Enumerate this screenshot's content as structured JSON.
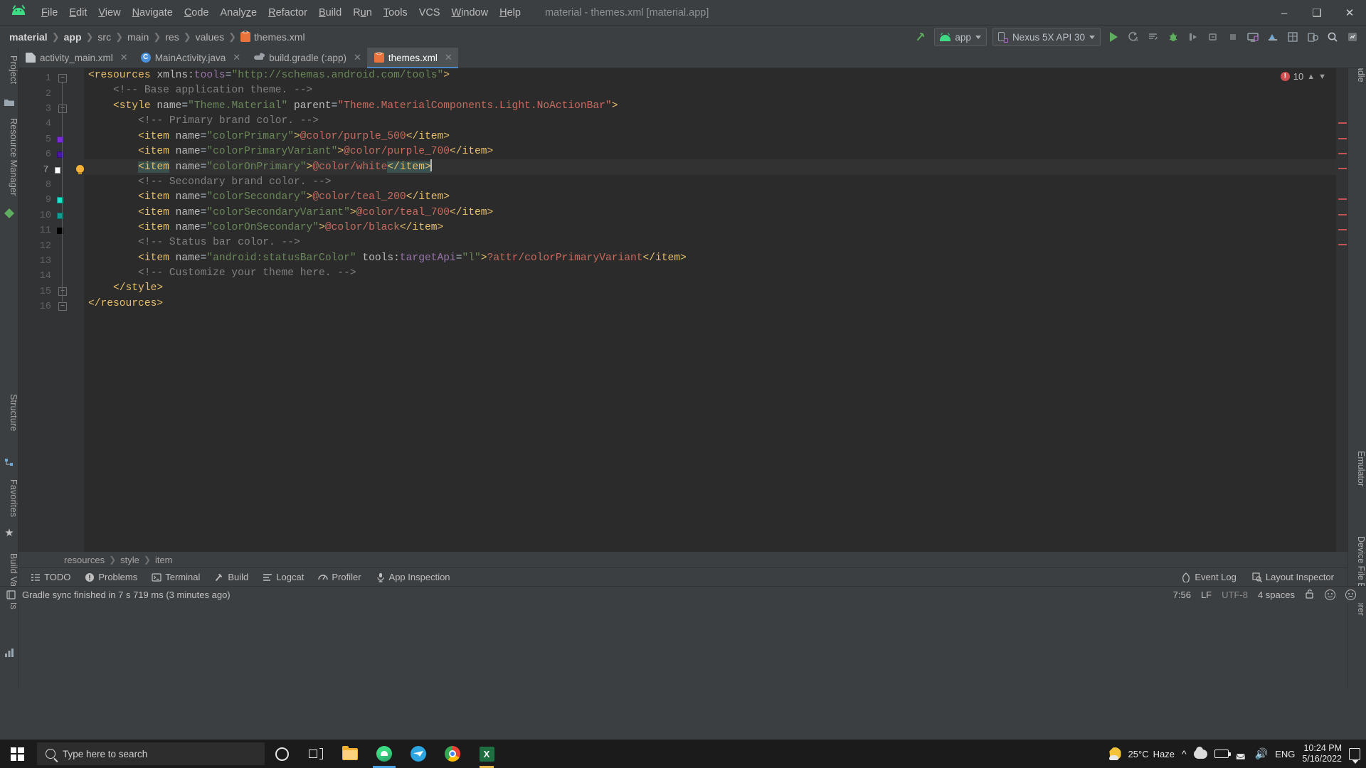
{
  "window": {
    "title": "material - themes.xml [material.app]",
    "app_icon": "android-logo-icon",
    "controls": {
      "minimize": "—",
      "maximize": "❐",
      "close": "✕"
    }
  },
  "menu": [
    {
      "label": "File",
      "mnemonic": "F"
    },
    {
      "label": "Edit",
      "mnemonic": "E"
    },
    {
      "label": "View",
      "mnemonic": "V"
    },
    {
      "label": "Navigate",
      "mnemonic": "N"
    },
    {
      "label": "Code",
      "mnemonic": "C"
    },
    {
      "label": "Analyze",
      "mnemonic": "z"
    },
    {
      "label": "Refactor",
      "mnemonic": "R"
    },
    {
      "label": "Build",
      "mnemonic": "B"
    },
    {
      "label": "Run",
      "mnemonic": "u"
    },
    {
      "label": "Tools",
      "mnemonic": "T"
    },
    {
      "label": "VCS",
      "mnemonic": ""
    },
    {
      "label": "Window",
      "mnemonic": "W"
    },
    {
      "label": "Help",
      "mnemonic": "H"
    }
  ],
  "breadcrumbs": [
    {
      "label": "material",
      "bold": true
    },
    {
      "label": "app",
      "bold": true
    },
    {
      "label": "src",
      "bold": false
    },
    {
      "label": "main",
      "bold": false
    },
    {
      "label": "res",
      "bold": false
    },
    {
      "label": "values",
      "bold": false
    },
    {
      "label": "themes.xml",
      "bold": false,
      "icon": "xml-file-icon"
    }
  ],
  "toolbar": {
    "build_hammer": "build-icon",
    "module_selector": "app",
    "device_selector": "Nexus 5X API 30",
    "run_button": "run-icon",
    "apply_changes": "apply-changes-icon",
    "apply_code_changes": "apply-code-changes-icon",
    "debug_button": "debug-icon",
    "profile_button": "profile-icon",
    "attach_debugger": "attach-debugger-icon",
    "stop_button": "stop-icon",
    "avd_manager": "avd-manager-icon",
    "sdk_manager": "sdk-manager-icon",
    "layout_inspector": "layout-inspector-icon",
    "device_file_explorer": "device-file-explorer-icon",
    "search_everywhere": "search-icon",
    "profiler": "profiler-icon"
  },
  "tabs": [
    {
      "label": "activity_main.xml",
      "icon": "xml-layout-icon",
      "active": false
    },
    {
      "label": "MainActivity.java",
      "icon": "java-class-icon",
      "active": false
    },
    {
      "label": "build.gradle (:app)",
      "icon": "gradle-icon",
      "active": false
    },
    {
      "label": "themes.xml",
      "icon": "xml-values-icon",
      "active": true
    }
  ],
  "left_tool_window_bars": [
    {
      "label": "Project",
      "icon": "project-icon"
    },
    {
      "label": "Resource Manager",
      "icon": "resource-manager-icon"
    },
    {
      "label": "Structure",
      "icon": "structure-icon"
    },
    {
      "label": "Favorites",
      "icon": "favorites-star-icon"
    },
    {
      "label": "Build Variants",
      "icon": "build-variants-icon"
    }
  ],
  "right_tool_window_bars": [
    {
      "label": "Gradle",
      "icon": "gradle-icon"
    },
    {
      "label": "Emulator",
      "icon": "emulator-icon"
    },
    {
      "label": "Device File Explorer",
      "icon": "device-file-explorer-icon"
    }
  ],
  "editor": {
    "file": "themes.xml",
    "error_count": "10",
    "gutter_swatches": {
      "5": "#7f2bdc",
      "6": "#4a16a8",
      "7": "#ffffff",
      "9": "#17e5cb",
      "10": "#0e9d92",
      "11": "#000000"
    },
    "intention_bulb_line": 7,
    "caret_position": "7:56",
    "lines": [
      {
        "n": 1,
        "fold": "minus",
        "tokens": [
          {
            "t": "<",
            "c": "t-tag"
          },
          {
            "t": "resources",
            "c": "t-tag"
          },
          {
            "t": " ",
            "c": "t-text"
          },
          {
            "t": "xmlns:",
            "c": "t-attr"
          },
          {
            "t": "tools",
            "c": "t-ns"
          },
          {
            "t": "=",
            "c": "t-text"
          },
          {
            "t": "\"http://schemas.android.com/tools\"",
            "c": "t-val"
          },
          {
            "t": ">",
            "c": "t-tag"
          }
        ]
      },
      {
        "n": 2,
        "tokens": [
          {
            "t": "    <!-- Base application theme. -->",
            "c": "t-com"
          }
        ]
      },
      {
        "n": 3,
        "fold": "minus",
        "tokens": [
          {
            "t": "    <",
            "c": "t-tag"
          },
          {
            "t": "style ",
            "c": "t-tag"
          },
          {
            "t": "name",
            "c": "t-attr"
          },
          {
            "t": "=",
            "c": "t-text"
          },
          {
            "t": "\"Theme.Material\"",
            "c": "t-val"
          },
          {
            "t": " ",
            "c": "t-text"
          },
          {
            "t": "parent",
            "c": "t-attr"
          },
          {
            "t": "=",
            "c": "t-text"
          },
          {
            "t": "\"Theme.MaterialComponents.Light.NoActionBar\"",
            "c": "t-redstr"
          },
          {
            "t": ">",
            "c": "t-tag"
          }
        ]
      },
      {
        "n": 4,
        "tokens": [
          {
            "t": "        <!-- Primary brand color. -->",
            "c": "t-com"
          }
        ]
      },
      {
        "n": 5,
        "tokens": [
          {
            "t": "        <",
            "c": "t-tag"
          },
          {
            "t": "item ",
            "c": "t-tag"
          },
          {
            "t": "name",
            "c": "t-attr"
          },
          {
            "t": "=",
            "c": "t-text"
          },
          {
            "t": "\"colorPrimary\"",
            "c": "t-val"
          },
          {
            "t": ">",
            "c": "t-tag"
          },
          {
            "t": "@color/purple_500",
            "c": "t-redstr"
          },
          {
            "t": "</item>",
            "c": "t-tag"
          }
        ]
      },
      {
        "n": 6,
        "tokens": [
          {
            "t": "        <",
            "c": "t-tag"
          },
          {
            "t": "item ",
            "c": "t-tag"
          },
          {
            "t": "name",
            "c": "t-attr"
          },
          {
            "t": "=",
            "c": "t-text"
          },
          {
            "t": "\"colorPrimaryVariant\"",
            "c": "t-val"
          },
          {
            "t": ">",
            "c": "t-tag"
          },
          {
            "t": "@color/purple_700",
            "c": "t-redstr"
          },
          {
            "t": "</item>",
            "c": "t-tag"
          }
        ]
      },
      {
        "n": 7,
        "current": true,
        "tokens": [
          {
            "t": "        ",
            "c": "t-text"
          },
          {
            "t": "<item",
            "c": "t-tag hl-ident"
          },
          {
            "t": " ",
            "c": "t-text"
          },
          {
            "t": "name",
            "c": "t-attr"
          },
          {
            "t": "=",
            "c": "t-text"
          },
          {
            "t": "\"colorOnPrimary\"",
            "c": "t-val"
          },
          {
            "t": ">",
            "c": "t-tag"
          },
          {
            "t": "@color/white",
            "c": "t-redstr"
          },
          {
            "t": "</item>",
            "c": "t-tag hl-ident"
          }
        ]
      },
      {
        "n": 8,
        "tokens": [
          {
            "t": "        <!-- Secondary brand color. -->",
            "c": "t-com"
          }
        ]
      },
      {
        "n": 9,
        "tokens": [
          {
            "t": "        <",
            "c": "t-tag"
          },
          {
            "t": "item ",
            "c": "t-tag"
          },
          {
            "t": "name",
            "c": "t-attr"
          },
          {
            "t": "=",
            "c": "t-text"
          },
          {
            "t": "\"colorSecondary\"",
            "c": "t-val"
          },
          {
            "t": ">",
            "c": "t-tag"
          },
          {
            "t": "@color/teal_200",
            "c": "t-redstr"
          },
          {
            "t": "</item>",
            "c": "t-tag"
          }
        ]
      },
      {
        "n": 10,
        "tokens": [
          {
            "t": "        <",
            "c": "t-tag"
          },
          {
            "t": "item ",
            "c": "t-tag"
          },
          {
            "t": "name",
            "c": "t-attr"
          },
          {
            "t": "=",
            "c": "t-text"
          },
          {
            "t": "\"colorSecondaryVariant\"",
            "c": "t-val"
          },
          {
            "t": ">",
            "c": "t-tag"
          },
          {
            "t": "@color/teal_700",
            "c": "t-redstr"
          },
          {
            "t": "</item>",
            "c": "t-tag"
          }
        ]
      },
      {
        "n": 11,
        "tokens": [
          {
            "t": "        <",
            "c": "t-tag"
          },
          {
            "t": "item ",
            "c": "t-tag"
          },
          {
            "t": "name",
            "c": "t-attr"
          },
          {
            "t": "=",
            "c": "t-text"
          },
          {
            "t": "\"colorOnSecondary\"",
            "c": "t-val"
          },
          {
            "t": ">",
            "c": "t-tag"
          },
          {
            "t": "@color/black",
            "c": "t-redstr"
          },
          {
            "t": "</item>",
            "c": "t-tag"
          }
        ]
      },
      {
        "n": 12,
        "tokens": [
          {
            "t": "        <!-- Status bar color. -->",
            "c": "t-com"
          }
        ]
      },
      {
        "n": 13,
        "tokens": [
          {
            "t": "        <",
            "c": "t-tag"
          },
          {
            "t": "item ",
            "c": "t-tag"
          },
          {
            "t": "name",
            "c": "t-attr"
          },
          {
            "t": "=",
            "c": "t-text"
          },
          {
            "t": "\"android:statusBarColor\"",
            "c": "t-val"
          },
          {
            "t": " ",
            "c": "t-text"
          },
          {
            "t": "tools:",
            "c": "t-attr"
          },
          {
            "t": "targetApi",
            "c": "t-ns"
          },
          {
            "t": "=",
            "c": "t-text"
          },
          {
            "t": "\"l\"",
            "c": "t-val"
          },
          {
            "t": ">",
            "c": "t-tag"
          },
          {
            "t": "?attr/colorPrimaryVariant",
            "c": "t-redstr"
          },
          {
            "t": "</item>",
            "c": "t-tag"
          }
        ]
      },
      {
        "n": 14,
        "tokens": [
          {
            "t": "        <!-- Customize your theme here. -->",
            "c": "t-com"
          }
        ]
      },
      {
        "n": 15,
        "fold": "minus",
        "tokens": [
          {
            "t": "    </style>",
            "c": "t-tag"
          }
        ]
      },
      {
        "n": 16,
        "fold": "minus",
        "tokens": [
          {
            "t": "</resources>",
            "c": "t-tag"
          }
        ]
      }
    ],
    "breadcrumb_footer": [
      "resources",
      "style",
      "item"
    ]
  },
  "tool_windows": [
    {
      "label": "TODO",
      "icon": "todo-icon"
    },
    {
      "label": "Problems",
      "icon": "problems-icon"
    },
    {
      "label": "Terminal",
      "icon": "terminal-icon"
    },
    {
      "label": "Build",
      "icon": "build-hammer-icon"
    },
    {
      "label": "Logcat",
      "icon": "logcat-icon"
    },
    {
      "label": "Profiler",
      "icon": "profiler-icon"
    },
    {
      "label": "App Inspection",
      "icon": "app-inspection-icon"
    }
  ],
  "tool_windows_right": [
    {
      "label": "Event Log",
      "icon": "event-log-icon"
    },
    {
      "label": "Layout Inspector",
      "icon": "layout-inspector-icon"
    }
  ],
  "status_bar": {
    "message": "Gradle sync finished in 7 s 719 ms (3 minutes ago)",
    "caret": "7:56",
    "line_separator": "LF",
    "encoding": "UTF-8",
    "indent": "4 spaces",
    "lock_icon": "unlocked-icon",
    "happy_icon": "happy-face-icon",
    "sad_icon": "sad-face-icon"
  },
  "taskbar": {
    "search_placeholder": "Type here to search",
    "start_icon": "windows-start-icon",
    "items": [
      {
        "icon": "cortana-icon",
        "name": "cortana"
      },
      {
        "icon": "task-view-icon",
        "name": "task-view"
      },
      {
        "icon": "file-explorer-icon",
        "name": "file-explorer"
      },
      {
        "icon": "android-studio-icon",
        "name": "android-studio",
        "active": true
      },
      {
        "icon": "telegram-icon",
        "name": "telegram"
      },
      {
        "icon": "chrome-icon",
        "name": "chrome"
      },
      {
        "icon": "excel-icon",
        "name": "excel",
        "running": true
      }
    ],
    "weather": {
      "temperature": "25°C",
      "condition": "Haze",
      "icon": "moon-haze-icon"
    },
    "tray": [
      "show-hidden-icons-chevron",
      "cloud-icon",
      "battery-icon",
      "wifi-icon",
      "volume-icon"
    ],
    "language": "ENG",
    "time": "10:24 PM",
    "date": "5/16/2022",
    "notifications_icon": "action-center-icon"
  }
}
